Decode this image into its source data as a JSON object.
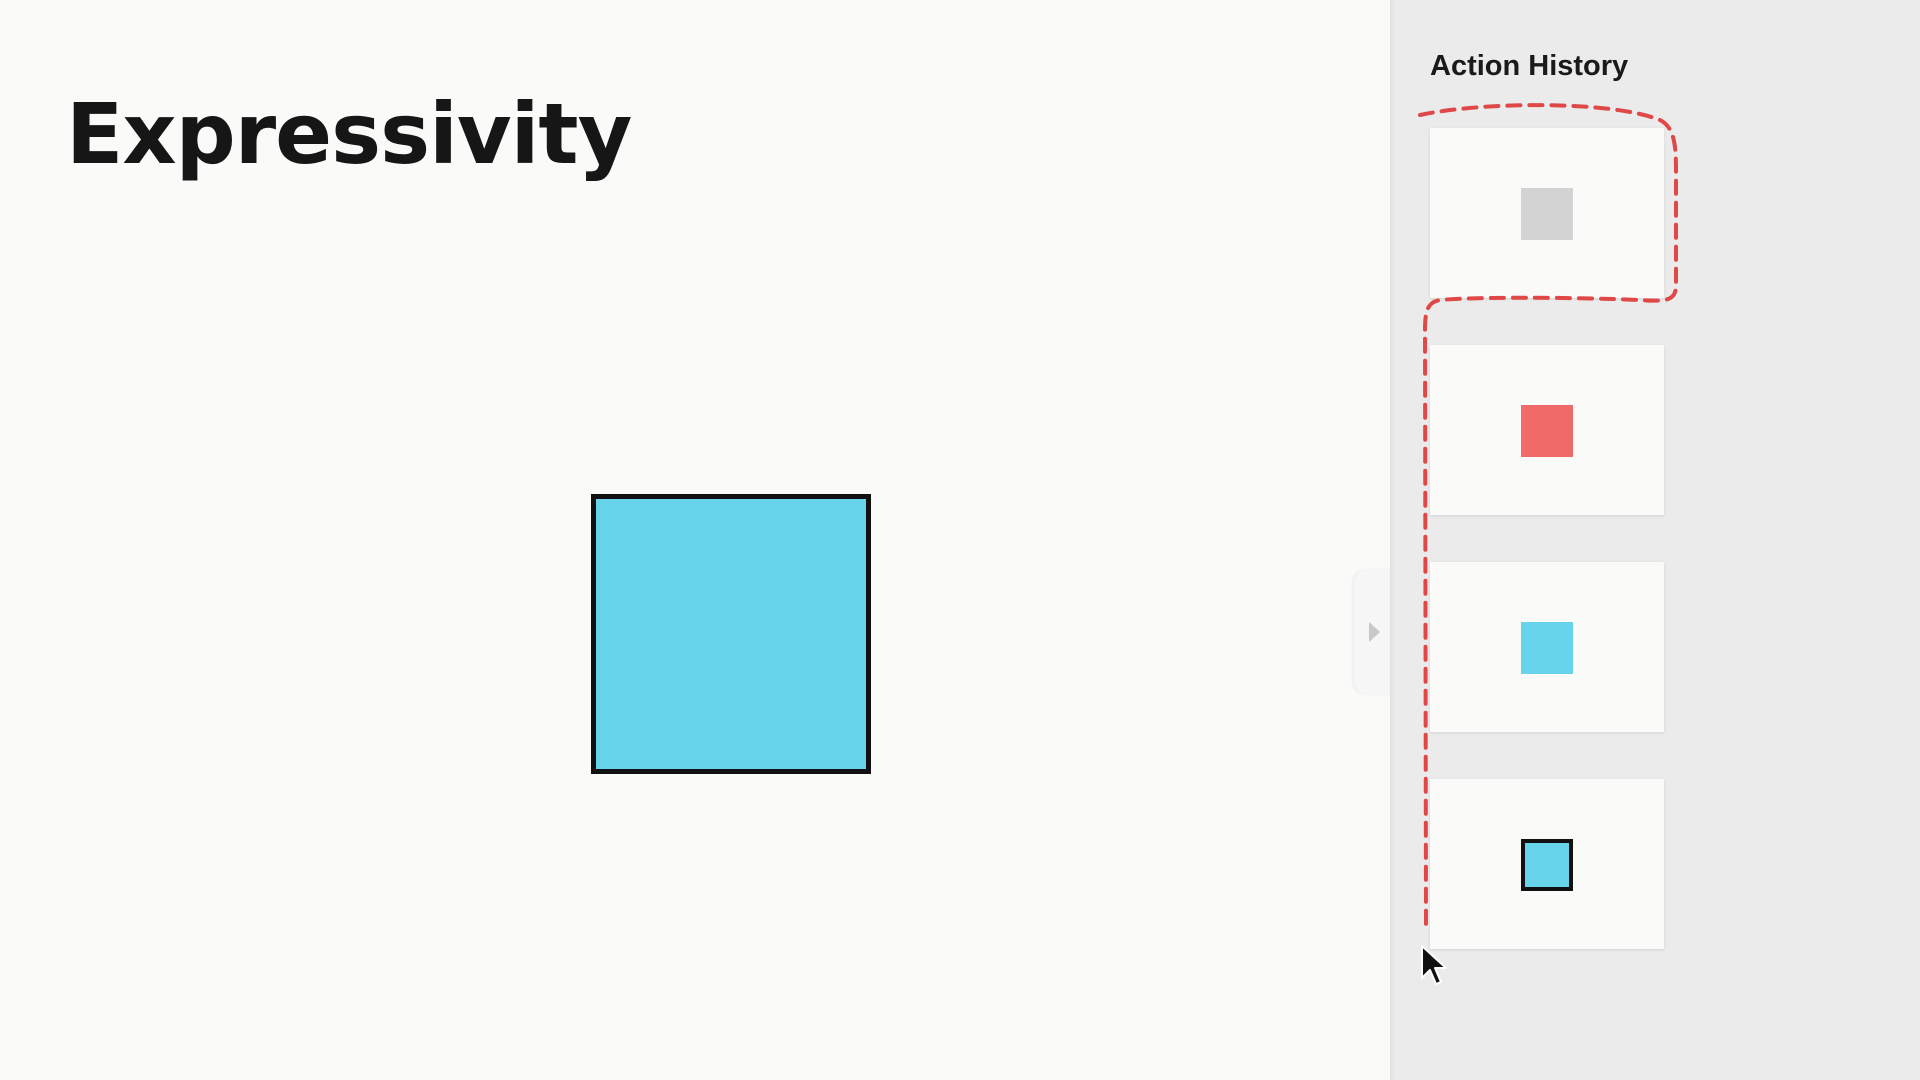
{
  "slide": {
    "title": "Expressivity"
  },
  "canvas": {
    "square_fill": "#68d4ec",
    "square_border": "#111111"
  },
  "action_history": {
    "title": "Action History",
    "items": [
      {
        "label": "gray square",
        "color": "#d3d3d3",
        "bordered": false,
        "selected": true
      },
      {
        "label": "red square",
        "color": "#ef6a68",
        "bordered": false,
        "selected": true
      },
      {
        "label": "cyan square",
        "color": "#68d4ec",
        "bordered": false,
        "selected": true
      },
      {
        "label": "cyan square with black border",
        "color": "#68d4ec",
        "bordered": true,
        "selected": true
      }
    ]
  },
  "selection_outline": {
    "color": "#e04848",
    "style": "dashed"
  },
  "sidebar_toggle": {
    "icon": "chevron-right-icon"
  }
}
